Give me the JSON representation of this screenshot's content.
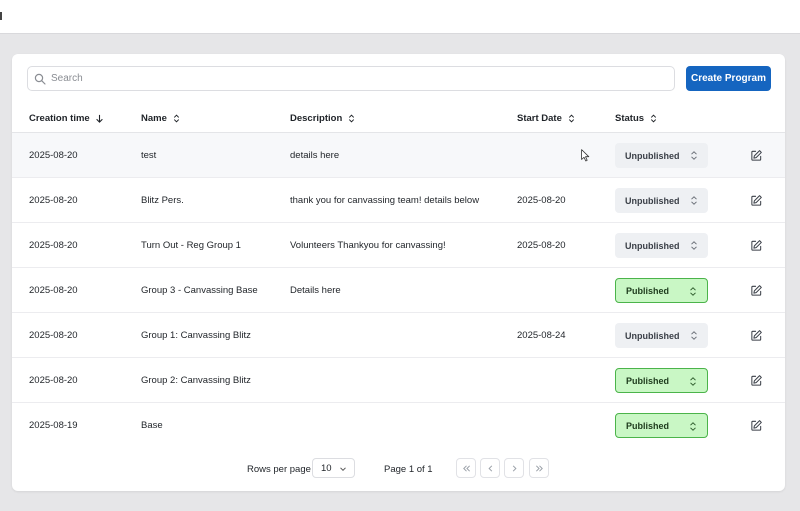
{
  "search": {
    "placeholder": "Search"
  },
  "toolbar": {
    "create_label": "Create Program"
  },
  "columns": {
    "creation_time": "Creation time",
    "name": "Name",
    "description": "Description",
    "start_date": "Start Date",
    "status": "Status"
  },
  "rows": [
    {
      "creation_time": "2025-08-20",
      "name": "test",
      "description": "details here",
      "start_date": "",
      "status": "Unpublished"
    },
    {
      "creation_time": "2025-08-20",
      "name": "Blitz Pers.",
      "description": "thank you for canvassing team! details below",
      "start_date": "2025-08-20",
      "status": "Unpublished"
    },
    {
      "creation_time": "2025-08-20",
      "name": "Turn Out - Reg Group 1",
      "description": "Volunteers Thankyou for canvassing!",
      "start_date": "2025-08-20",
      "status": "Unpublished"
    },
    {
      "creation_time": "2025-08-20",
      "name": "Group 3 - Canvassing Base",
      "description": "Details here",
      "start_date": "",
      "status": "Published"
    },
    {
      "creation_time": "2025-08-20",
      "name": "Group 1: Canvassing Blitz",
      "description": "",
      "start_date": "2025-08-24",
      "status": "Unpublished"
    },
    {
      "creation_time": "2025-08-20",
      "name": "Group 2: Canvassing Blitz",
      "description": "",
      "start_date": "",
      "status": "Published"
    },
    {
      "creation_time": "2025-08-19",
      "name": "Base",
      "description": "",
      "start_date": "",
      "status": "Published"
    }
  ],
  "pagination": {
    "rows_per_page_label": "Rows per page",
    "rows_per_page": "10",
    "page_label": "Page 1 of 1"
  },
  "colors": {
    "accent": "#1565c0",
    "published_bg": "#c9f7c5",
    "published_border": "#4bb44a",
    "unpublished_bg": "#eef0f3"
  },
  "icons": {
    "search": "search-icon",
    "sort_desc": "arrow-down-icon",
    "sort": "sort-icon",
    "select": "chevron-updown-icon",
    "edit": "edit-icon",
    "first": "chevrons-left-icon",
    "prev": "chevron-left-icon",
    "next": "chevron-right-icon",
    "last": "chevrons-right-icon"
  }
}
